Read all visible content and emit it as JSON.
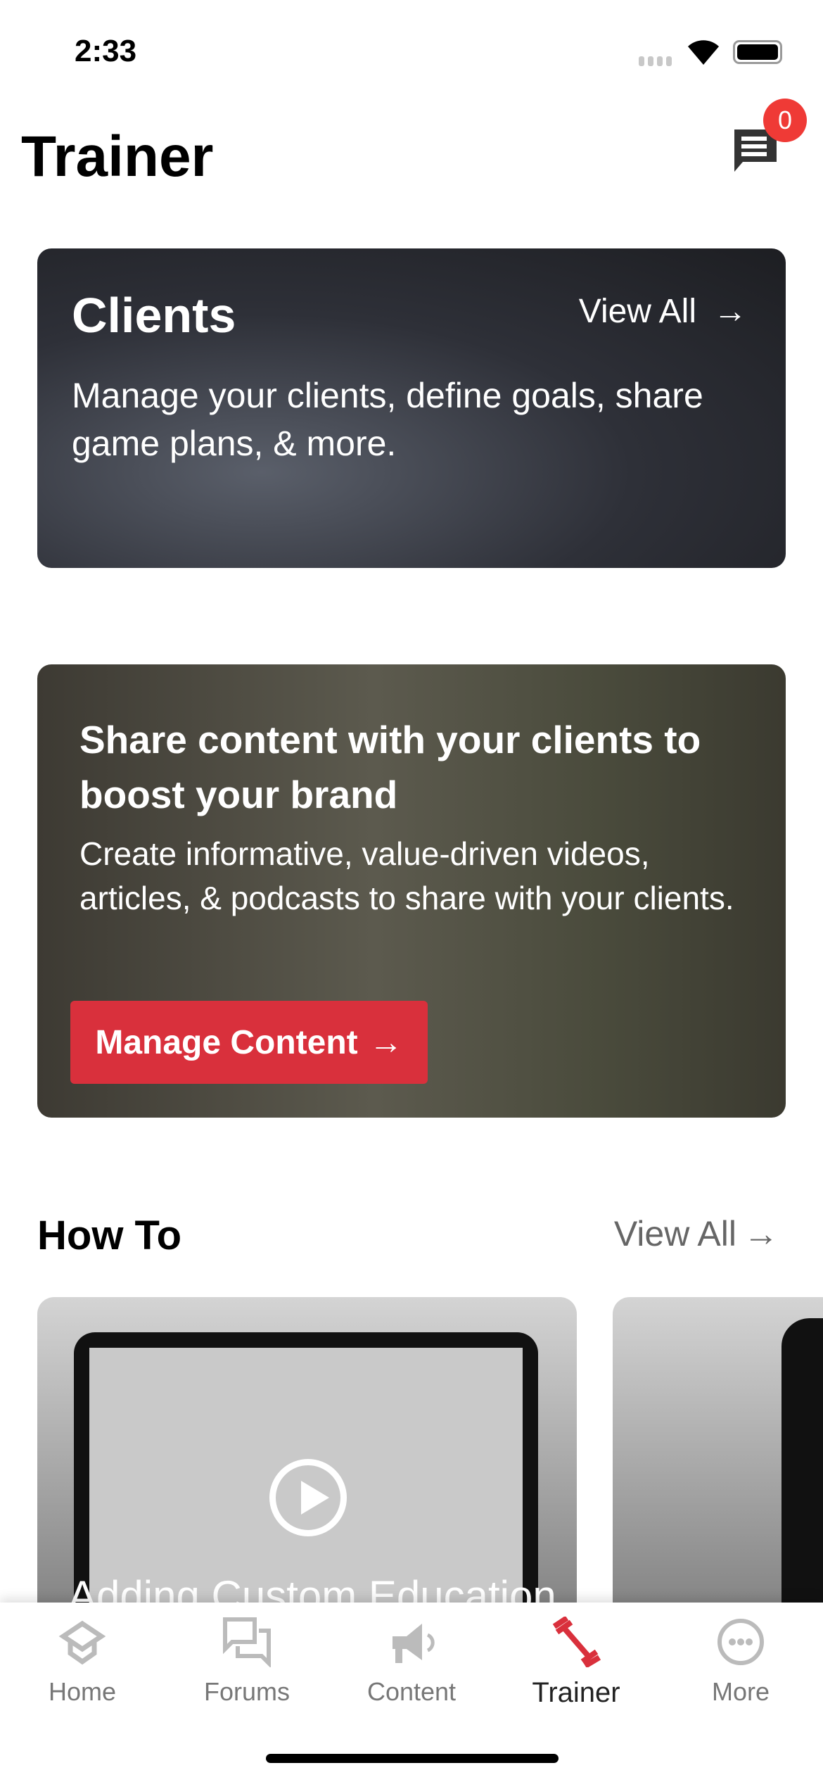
{
  "status_bar": {
    "time": "2:33"
  },
  "header": {
    "title": "Trainer",
    "messages_badge": "0"
  },
  "clients_card": {
    "title": "Clients",
    "view_all": "View All",
    "description": "Manage your clients, define goals, share game plans, & more."
  },
  "content_card": {
    "title": "Share content with your clients to boost your brand",
    "description": "Create informative, value-driven videos, articles, & podcasts to share with your clients.",
    "button": "Manage Content"
  },
  "how_to": {
    "title": "How To",
    "view_all": "View All",
    "videos": [
      {
        "title": "Adding Custom Education"
      }
    ]
  },
  "tab_bar": {
    "items": [
      {
        "label": "Home"
      },
      {
        "label": "Forums"
      },
      {
        "label": "Content"
      },
      {
        "label": "Trainer"
      },
      {
        "label": "More"
      }
    ],
    "active": "Trainer",
    "active_color": "#d9303c"
  },
  "colors": {
    "accent": "#d9303c",
    "badge": "#ef3a36"
  }
}
